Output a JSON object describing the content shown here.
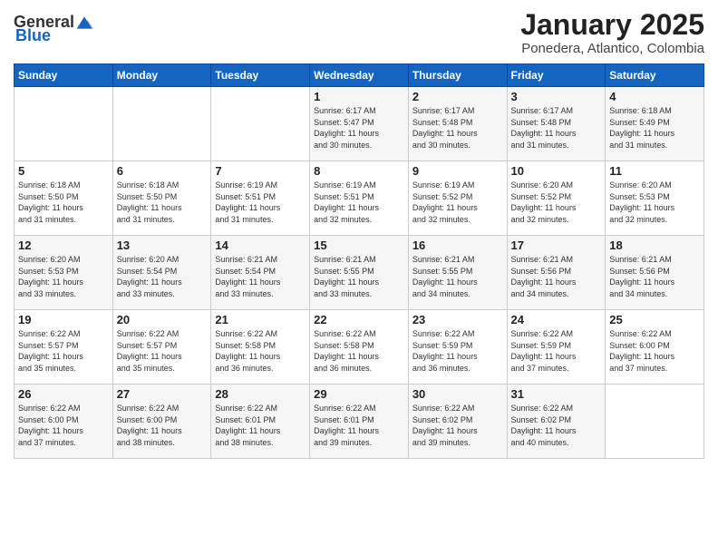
{
  "header": {
    "logo_general": "General",
    "logo_blue": "Blue",
    "month": "January 2025",
    "location": "Ponedera, Atlantico, Colombia"
  },
  "days_of_week": [
    "Sunday",
    "Monday",
    "Tuesday",
    "Wednesday",
    "Thursday",
    "Friday",
    "Saturday"
  ],
  "weeks": [
    [
      {
        "day": "",
        "info": ""
      },
      {
        "day": "",
        "info": ""
      },
      {
        "day": "",
        "info": ""
      },
      {
        "day": "1",
        "info": "Sunrise: 6:17 AM\nSunset: 5:47 PM\nDaylight: 11 hours\nand 30 minutes."
      },
      {
        "day": "2",
        "info": "Sunrise: 6:17 AM\nSunset: 5:48 PM\nDaylight: 11 hours\nand 30 minutes."
      },
      {
        "day": "3",
        "info": "Sunrise: 6:17 AM\nSunset: 5:48 PM\nDaylight: 11 hours\nand 31 minutes."
      },
      {
        "day": "4",
        "info": "Sunrise: 6:18 AM\nSunset: 5:49 PM\nDaylight: 11 hours\nand 31 minutes."
      }
    ],
    [
      {
        "day": "5",
        "info": "Sunrise: 6:18 AM\nSunset: 5:50 PM\nDaylight: 11 hours\nand 31 minutes."
      },
      {
        "day": "6",
        "info": "Sunrise: 6:18 AM\nSunset: 5:50 PM\nDaylight: 11 hours\nand 31 minutes."
      },
      {
        "day": "7",
        "info": "Sunrise: 6:19 AM\nSunset: 5:51 PM\nDaylight: 11 hours\nand 31 minutes."
      },
      {
        "day": "8",
        "info": "Sunrise: 6:19 AM\nSunset: 5:51 PM\nDaylight: 11 hours\nand 32 minutes."
      },
      {
        "day": "9",
        "info": "Sunrise: 6:19 AM\nSunset: 5:52 PM\nDaylight: 11 hours\nand 32 minutes."
      },
      {
        "day": "10",
        "info": "Sunrise: 6:20 AM\nSunset: 5:52 PM\nDaylight: 11 hours\nand 32 minutes."
      },
      {
        "day": "11",
        "info": "Sunrise: 6:20 AM\nSunset: 5:53 PM\nDaylight: 11 hours\nand 32 minutes."
      }
    ],
    [
      {
        "day": "12",
        "info": "Sunrise: 6:20 AM\nSunset: 5:53 PM\nDaylight: 11 hours\nand 33 minutes."
      },
      {
        "day": "13",
        "info": "Sunrise: 6:20 AM\nSunset: 5:54 PM\nDaylight: 11 hours\nand 33 minutes."
      },
      {
        "day": "14",
        "info": "Sunrise: 6:21 AM\nSunset: 5:54 PM\nDaylight: 11 hours\nand 33 minutes."
      },
      {
        "day": "15",
        "info": "Sunrise: 6:21 AM\nSunset: 5:55 PM\nDaylight: 11 hours\nand 33 minutes."
      },
      {
        "day": "16",
        "info": "Sunrise: 6:21 AM\nSunset: 5:55 PM\nDaylight: 11 hours\nand 34 minutes."
      },
      {
        "day": "17",
        "info": "Sunrise: 6:21 AM\nSunset: 5:56 PM\nDaylight: 11 hours\nand 34 minutes."
      },
      {
        "day": "18",
        "info": "Sunrise: 6:21 AM\nSunset: 5:56 PM\nDaylight: 11 hours\nand 34 minutes."
      }
    ],
    [
      {
        "day": "19",
        "info": "Sunrise: 6:22 AM\nSunset: 5:57 PM\nDaylight: 11 hours\nand 35 minutes."
      },
      {
        "day": "20",
        "info": "Sunrise: 6:22 AM\nSunset: 5:57 PM\nDaylight: 11 hours\nand 35 minutes."
      },
      {
        "day": "21",
        "info": "Sunrise: 6:22 AM\nSunset: 5:58 PM\nDaylight: 11 hours\nand 36 minutes."
      },
      {
        "day": "22",
        "info": "Sunrise: 6:22 AM\nSunset: 5:58 PM\nDaylight: 11 hours\nand 36 minutes."
      },
      {
        "day": "23",
        "info": "Sunrise: 6:22 AM\nSunset: 5:59 PM\nDaylight: 11 hours\nand 36 minutes."
      },
      {
        "day": "24",
        "info": "Sunrise: 6:22 AM\nSunset: 5:59 PM\nDaylight: 11 hours\nand 37 minutes."
      },
      {
        "day": "25",
        "info": "Sunrise: 6:22 AM\nSunset: 6:00 PM\nDaylight: 11 hours\nand 37 minutes."
      }
    ],
    [
      {
        "day": "26",
        "info": "Sunrise: 6:22 AM\nSunset: 6:00 PM\nDaylight: 11 hours\nand 37 minutes."
      },
      {
        "day": "27",
        "info": "Sunrise: 6:22 AM\nSunset: 6:00 PM\nDaylight: 11 hours\nand 38 minutes."
      },
      {
        "day": "28",
        "info": "Sunrise: 6:22 AM\nSunset: 6:01 PM\nDaylight: 11 hours\nand 38 minutes."
      },
      {
        "day": "29",
        "info": "Sunrise: 6:22 AM\nSunset: 6:01 PM\nDaylight: 11 hours\nand 39 minutes."
      },
      {
        "day": "30",
        "info": "Sunrise: 6:22 AM\nSunset: 6:02 PM\nDaylight: 11 hours\nand 39 minutes."
      },
      {
        "day": "31",
        "info": "Sunrise: 6:22 AM\nSunset: 6:02 PM\nDaylight: 11 hours\nand 40 minutes."
      },
      {
        "day": "",
        "info": ""
      }
    ]
  ]
}
